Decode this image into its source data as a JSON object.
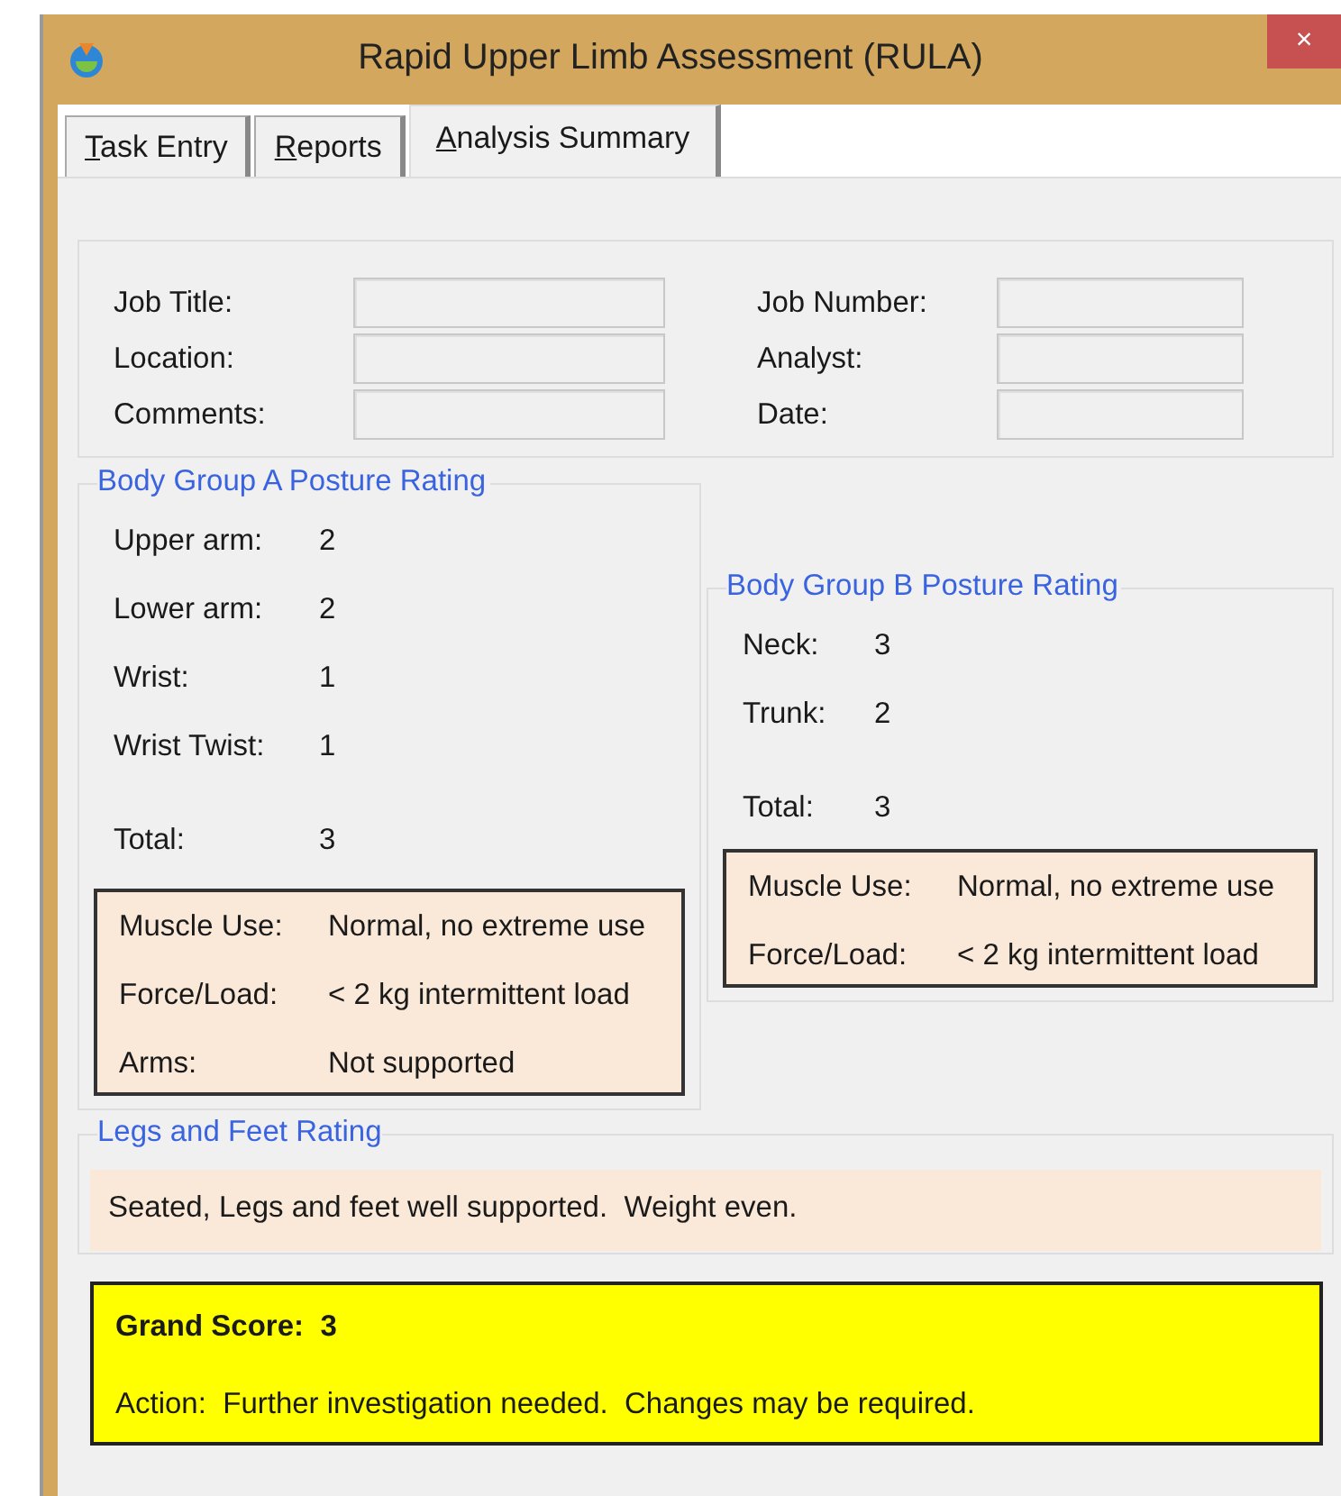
{
  "window": {
    "title": "Rapid Upper Limb Assessment (RULA)",
    "close": "×"
  },
  "tabs": [
    {
      "label": "Task Entry",
      "mnemonic_first": true,
      "selected": false
    },
    {
      "label": "Reports",
      "mnemonic_first": true,
      "selected": false
    },
    {
      "label": "Analysis Summary",
      "mnemonic_first": true,
      "selected": true
    }
  ],
  "job_info": {
    "columns": [
      [
        {
          "label": "Job Title:"
        },
        {
          "label": "Location:"
        },
        {
          "label": "Comments:"
        }
      ],
      [
        {
          "label": "Job Number:"
        },
        {
          "label": "Analyst:"
        },
        {
          "label": "Date:"
        }
      ]
    ]
  },
  "group_a": {
    "title": "Body Group A Posture Rating",
    "ratings": [
      {
        "label": "Upper arm:",
        "value": "2"
      },
      {
        "label": "Lower arm:",
        "value": "2"
      },
      {
        "label": "Wrist:",
        "value": "1"
      },
      {
        "label": "Wrist Twist:",
        "value": "1"
      }
    ],
    "total": {
      "label": "Total:",
      "value": "3"
    },
    "factors": [
      {
        "label": "Muscle Use:",
        "value": "Normal, no extreme use"
      },
      {
        "label": "Force/Load:",
        "value": "< 2 kg intermittent load"
      },
      {
        "label": "Arms:",
        "value": "Not supported"
      }
    ]
  },
  "group_b": {
    "title": "Body Group B Posture Rating",
    "ratings": [
      {
        "label": "Neck:",
        "value": "3"
      },
      {
        "label": "Trunk:",
        "value": "2"
      }
    ],
    "total": {
      "label": "Total:",
      "value": "3"
    },
    "factors": [
      {
        "label": "Muscle Use:",
        "value": "Normal, no extreme use"
      },
      {
        "label": "Force/Load:",
        "value": "< 2 kg intermittent load"
      }
    ]
  },
  "legs": {
    "title": "Legs and Feet Rating",
    "text": "Seated, Legs and feet well supported.  Weight even."
  },
  "grand": {
    "score": "Grand Score:  3",
    "action": "Action:  Further investigation needed.  Changes may be required."
  }
}
